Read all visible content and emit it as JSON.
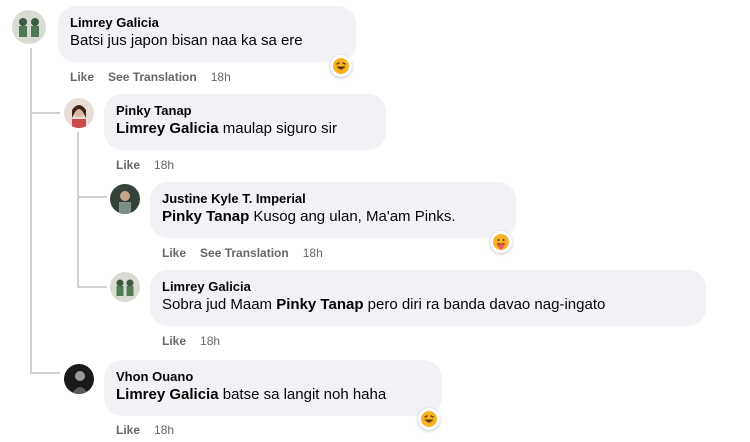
{
  "comments": [
    {
      "author": "Limrey Galicia",
      "text": "Batsi jus japon bisan naa ka sa ere",
      "like": "Like",
      "translate": "See Translation",
      "time": "18h",
      "reaction": "haha-emoji"
    },
    {
      "author": "Pinky Tanap",
      "mention": "Limrey Galicia",
      "text": " maulap siguro sir",
      "like": "Like",
      "time": "18h"
    },
    {
      "author": "Justine Kyle T. Imperial",
      "mention": "Pinky Tanap",
      "text": " Kusog ang ulan, Ma'am Pinks.",
      "like": "Like",
      "translate": "See Translation",
      "time": "18h",
      "reaction": "care-emoji"
    },
    {
      "author": "Limrey Galicia",
      "text_before": "Sobra jud Maam ",
      "mention": "Pinky Tanap",
      "text_after": " pero diri ra banda davao nag-ingato",
      "like": "Like",
      "time": "18h"
    },
    {
      "author": "Vhon Ouano",
      "mention": "Limrey Galicia",
      "text": " batse sa langit noh haha",
      "like": "Like",
      "time": "18h",
      "reaction": "haha-emoji"
    }
  ],
  "colors": {
    "bubble": "#f0f2f5",
    "secondary_text": "#65676b",
    "thread_line": "#ced0d4"
  }
}
